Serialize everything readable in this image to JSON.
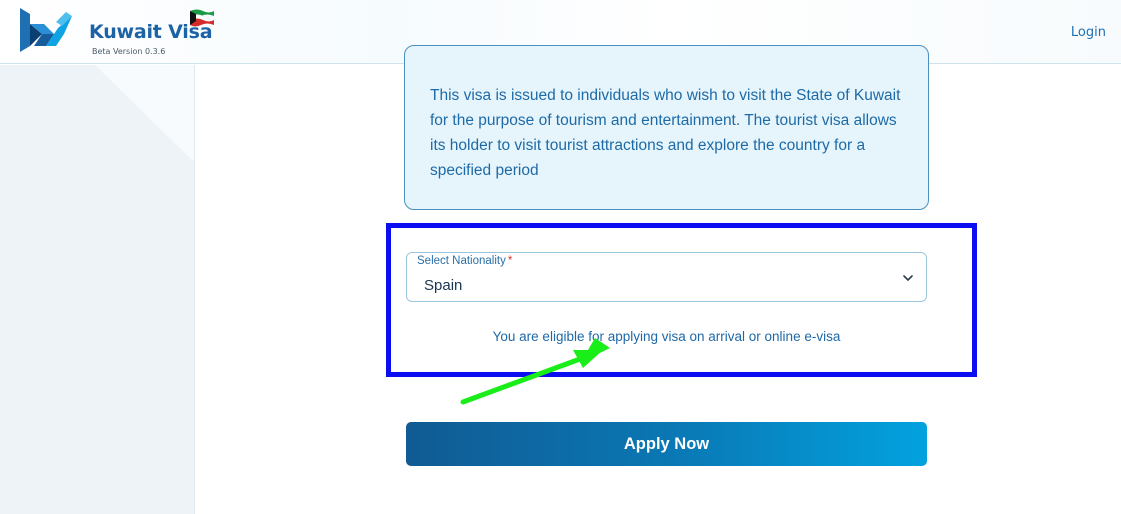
{
  "header": {
    "brand_title": "Kuwait Visa",
    "brand_version": "Beta Version 0.3.6",
    "login_label": "Login",
    "logo_icon": "kuwait-visa-logo-icon",
    "flag_icon": "kuwait-flag-icon"
  },
  "info_card": {
    "description": "This visa is issued to individuals who wish to visit the State of Kuwait for the purpose of tourism and entertainment. The tourist visa allows its holder to visit tourist attractions and explore the country for a specified period"
  },
  "form": {
    "nationality_label": "Select Nationality",
    "required_marker": "*",
    "nationality_value": "Spain",
    "eligibility_message": "You are eligible for applying visa on arrival or online e-visa",
    "apply_label": "Apply Now"
  },
  "colors": {
    "brand_blue": "#1b63a6",
    "highlight_box": "#0a0ef0",
    "annotation_arrow": "#19ee19",
    "button_start": "#115a93",
    "button_end": "#02a2df"
  }
}
